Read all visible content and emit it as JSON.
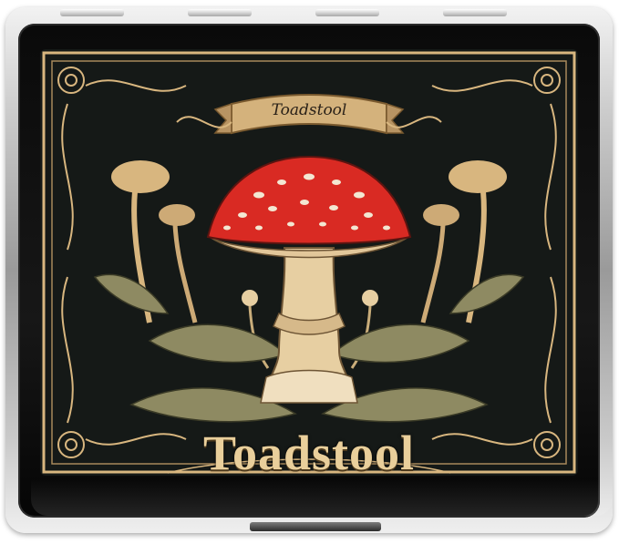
{
  "banner": {
    "label": "Toadstool"
  },
  "title": {
    "label": "Toadstool"
  },
  "colors": {
    "background": "#151917",
    "gold": "#d8b67f",
    "cap_red": "#d92a23",
    "stem": "#e7cfa2",
    "leaf": "#8e8a62"
  }
}
